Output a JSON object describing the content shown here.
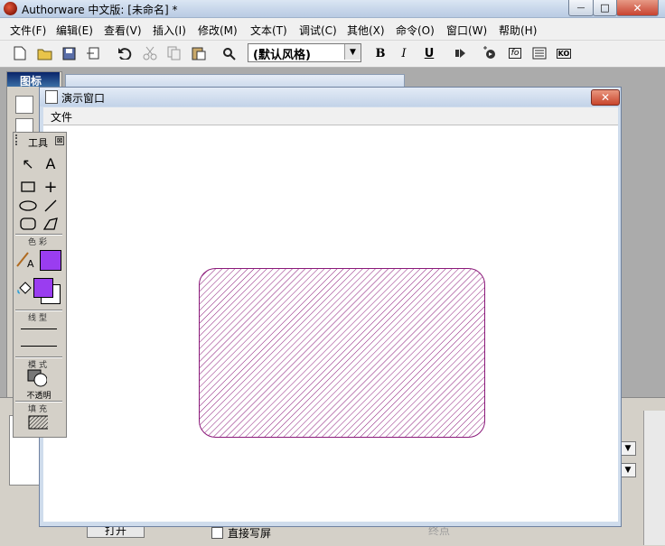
{
  "window": {
    "title": "Authorware 中文版: [未命名] *",
    "minimize_glyph": "—",
    "maximize_glyph": "□",
    "close_glyph": "✕"
  },
  "menubar": {
    "items": [
      "文件(F)",
      "编辑(E)",
      "查看(V)",
      "插入(I)",
      "修改(M)",
      "文本(T)",
      "调试(C)",
      "其他(X)",
      "命令(O)",
      "窗口(W)",
      "帮助(H)"
    ]
  },
  "toolbar": {
    "style_select_value": "(默认风格)",
    "bold_label": "B",
    "italic_label": "I",
    "underline_label": "U",
    "func_label": "fo",
    "ko_label": "KO"
  },
  "icons_panel": {
    "title": "图标"
  },
  "presentation_window": {
    "title": "演示窗口",
    "close_glyph": "✕",
    "menu_file": "文件"
  },
  "tools_palette": {
    "title": "工具",
    "close_glyph": "⊠",
    "pointer_glyph": "↖",
    "text_tool_glyph": "A",
    "crosshair_glyph": "+",
    "section_color": "色彩",
    "section_line": "线型",
    "section_mode": "模式",
    "section_fill": "填充",
    "mode_value": "不透明",
    "fill_color": "#9a3df0",
    "line_color_swatch": "#9a3df0",
    "shape_stroke_color": "#8b1a7a"
  },
  "properties_panel": {
    "open_button": "打开",
    "direct_write_label": "直接写屏",
    "endpoint_label": "终点"
  }
}
